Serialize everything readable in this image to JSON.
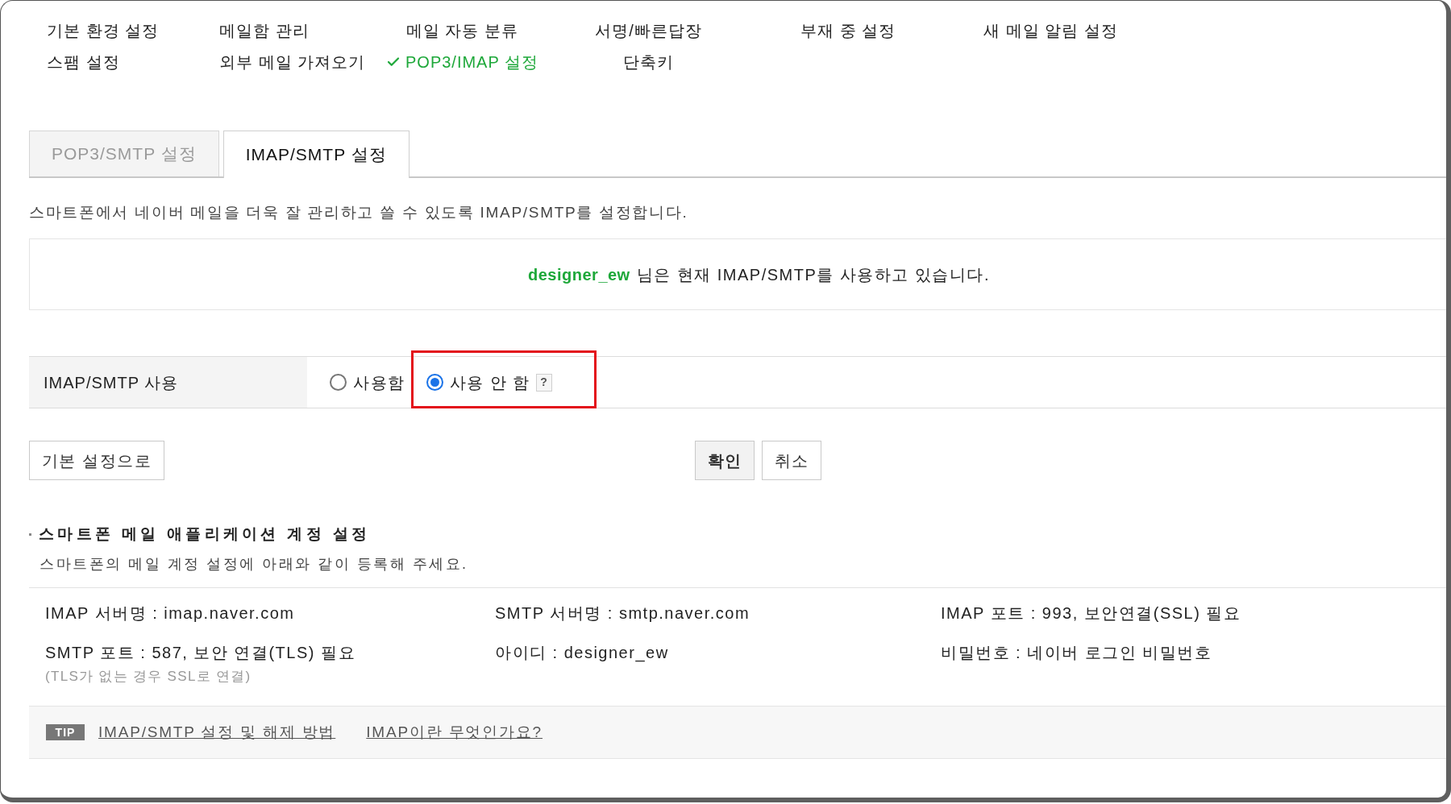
{
  "nav": {
    "rows": [
      [
        {
          "label": "기본 환경 설정",
          "selected": false
        },
        {
          "label": "메일함 관리",
          "selected": false
        },
        {
          "label": "메일 자동 분류",
          "selected": false
        },
        {
          "label": "서명/빠른답장",
          "selected": false
        },
        {
          "label": "부재 중 설정",
          "selected": false
        },
        {
          "label": "새 메일 알림 설정",
          "selected": false
        }
      ],
      [
        {
          "label": "스팸 설정",
          "selected": false
        },
        {
          "label": "외부 메일 가져오기",
          "selected": false
        },
        {
          "label": "POP3/IMAP 설정",
          "selected": true
        },
        {
          "label": "단축키",
          "selected": false
        }
      ]
    ]
  },
  "tabs": [
    {
      "label": "POP3/SMTP 설정",
      "selected": false
    },
    {
      "label": "IMAP/SMTP 설정",
      "selected": true
    }
  ],
  "description": "스마트폰에서 네이버 메일을 더욱 잘 관리하고 쓸 수 있도록 IMAP/SMTP를 설정합니다.",
  "status": {
    "user": "designer_ew",
    "message": "님은 현재 IMAP/SMTP를 사용하고 있습니다."
  },
  "setting": {
    "label": "IMAP/SMTP 사용",
    "options": [
      {
        "label": "사용함",
        "selected": false,
        "highlighted": false
      },
      {
        "label": "사용 안 함",
        "selected": true,
        "highlighted": true,
        "help": "?"
      }
    ]
  },
  "buttons": {
    "left": [
      {
        "label": "기본 설정으로",
        "kind": "secondary"
      }
    ],
    "center": [
      {
        "label": "확인",
        "kind": "primary"
      },
      {
        "label": "취소",
        "kind": "secondary"
      }
    ]
  },
  "account": {
    "title": "스마트폰 메일 애플리케이션 계정 설정",
    "subtitle": "스마트폰의 메일 계정 설정에 아래와 같이 등록해 주세요.",
    "rows": [
      [
        {
          "text": "IMAP 서버명 : imap.naver.com"
        },
        {
          "text": "SMTP 서버명 : smtp.naver.com"
        },
        {
          "text": "IMAP 포트 : 993, 보안연결(SSL) 필요"
        }
      ],
      [
        {
          "text": "SMTP 포트 : 587, 보안 연결(TLS) 필요",
          "note": "(TLS가 없는 경우 SSL로 연결)"
        },
        {
          "text": "아이디 : designer_ew"
        },
        {
          "text": "비밀번호 : 네이버 로그인 비밀번호"
        }
      ]
    ]
  },
  "tip": {
    "badge": "TIP",
    "links": [
      "IMAP/SMTP 설정 및 해제 방법",
      "IMAP이란 무엇인가요?"
    ]
  }
}
